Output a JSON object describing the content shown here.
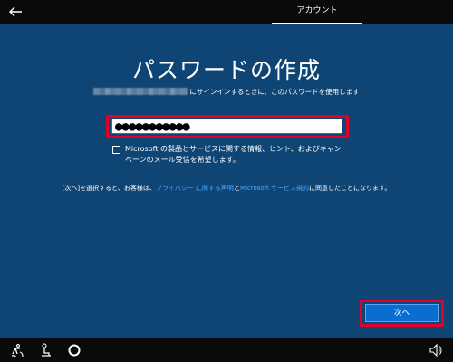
{
  "header": {
    "back_icon": "back-arrow-icon",
    "tab_label": "アカウント"
  },
  "main": {
    "title": "パスワードの作成",
    "subtitle": "にサインインするときに、このパスワードを使用します",
    "password_value": "●●●●●●●●●●●",
    "optin_line1": "Microsoft の製品とサービスに関する情報、ヒント、およびキャン",
    "optin_line2": "ペーンのメール受信を希望します。",
    "legal_prefix": "[次へ]を選択すると、お客様は、",
    "legal_link1": "プライバシー に関する声明",
    "legal_mid": "と",
    "legal_link2": "Microsoft サービス規約",
    "legal_suffix": "に同意したことになります。",
    "next_label": "次へ"
  },
  "footer": {
    "icons": [
      "ease-of-access-icon",
      "accessibility-person-icon",
      "cortana-icon",
      "volume-icon"
    ]
  },
  "colors": {
    "background": "#0f4575",
    "highlight": "#e0002a",
    "button": "#0a6ed1",
    "link": "#49a6ff"
  }
}
